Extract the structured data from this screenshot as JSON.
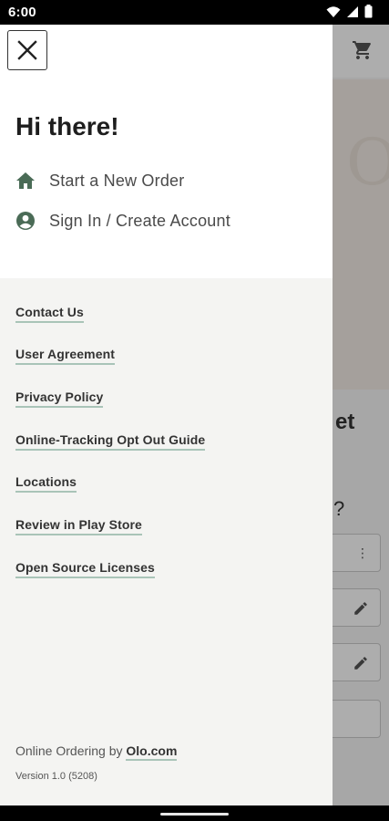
{
  "status_bar": {
    "time": "6:00"
  },
  "drawer": {
    "greeting": "Hi there!",
    "nav_items": [
      {
        "label": "Start a New Order",
        "icon": "home-icon"
      },
      {
        "label": "Sign In / Create Account",
        "icon": "account-circle-icon"
      }
    ],
    "links": [
      "Contact Us",
      "User Agreement",
      "Privacy Policy",
      "Online-Tracking Opt Out Guide",
      "Locations",
      "Review in Play Store",
      "Open Source Licenses"
    ],
    "footer": {
      "prefix": "Online Ordering by",
      "link": "Olo.com",
      "version": "Version 1.0 (5208)"
    }
  },
  "background": {
    "heading_fragment": "et",
    "question_fragment": "?"
  },
  "colors": {
    "accent": "#4a6b56",
    "link_underline": "#a9c4b8",
    "drawer_bg": "#f4f4f2"
  }
}
